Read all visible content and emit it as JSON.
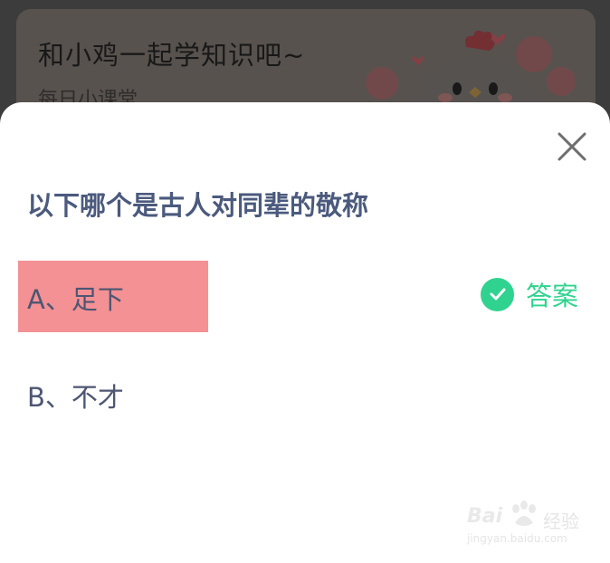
{
  "background": {
    "title": "和小鸡一起学知识吧~",
    "subtitle": "每日小课堂",
    "mascot_icon": "chicken-mascot"
  },
  "dialog": {
    "question": "以下哪个是古人对同辈的敬称",
    "close_icon": "close-icon",
    "options": [
      {
        "label": "A、足下",
        "highlighted": true
      },
      {
        "label": "B、不才",
        "highlighted": false
      }
    ],
    "answer": {
      "icon": "check-circle-icon",
      "label": "答案"
    }
  },
  "watermark": {
    "brand": "Bai",
    "brand_cn": "经验",
    "url": "jingyan.baidu.com"
  },
  "colors": {
    "question_text": "#4b5a7d",
    "option_text": "#4d5672",
    "highlight": "#f49194",
    "answer_green": "#2fd38f"
  }
}
